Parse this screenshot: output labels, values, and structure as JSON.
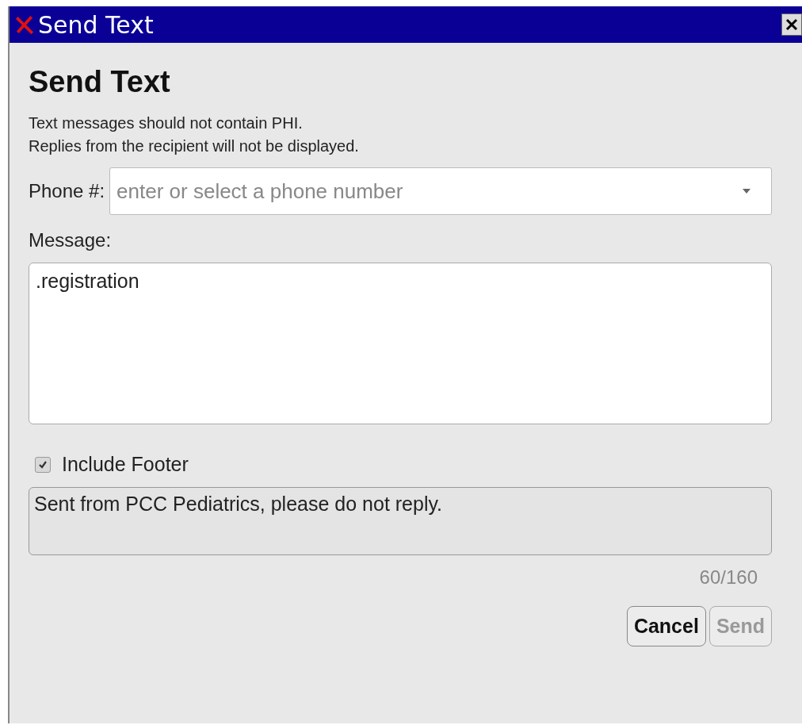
{
  "window": {
    "title": "Send Text"
  },
  "heading": "Send Text",
  "notice": [
    "Text messages should not contain PHI.",
    "Replies from the recipient will not be displayed."
  ],
  "phone": {
    "label": "Phone #:",
    "placeholder": "enter or select a phone number"
  },
  "message": {
    "label": "Message:",
    "value": ".registration"
  },
  "include_footer": {
    "label": "Include Footer",
    "checked": true
  },
  "footer": {
    "value": "Sent from PCC Pediatrics, please do not reply.",
    "disabled": true
  },
  "counter": "60/160",
  "buttons": [
    {
      "label": "Cancel",
      "disabled": false
    },
    {
      "label": "Send",
      "disabled": true
    }
  ]
}
